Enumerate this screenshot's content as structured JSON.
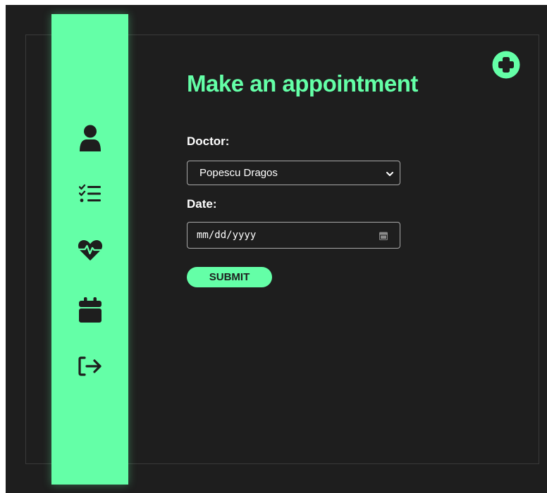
{
  "theme": {
    "accent": "#64ffa7",
    "background": "#1e1e1e",
    "text": "#ffffff"
  },
  "sidebar": {
    "items": [
      {
        "icon": "user-icon"
      },
      {
        "icon": "checklist-icon"
      },
      {
        "icon": "heartbeat-icon"
      },
      {
        "icon": "calendar-icon"
      },
      {
        "icon": "logout-icon"
      }
    ]
  },
  "header": {
    "add_icon": "plus-circle-icon"
  },
  "form": {
    "title": "Make an appointment",
    "doctor_label": "Doctor:",
    "doctor_selected": "Popescu Dragos",
    "date_label": "Date:",
    "date_placeholder": "mm/dd/yyyy",
    "submit_label": "SUBMIT"
  }
}
